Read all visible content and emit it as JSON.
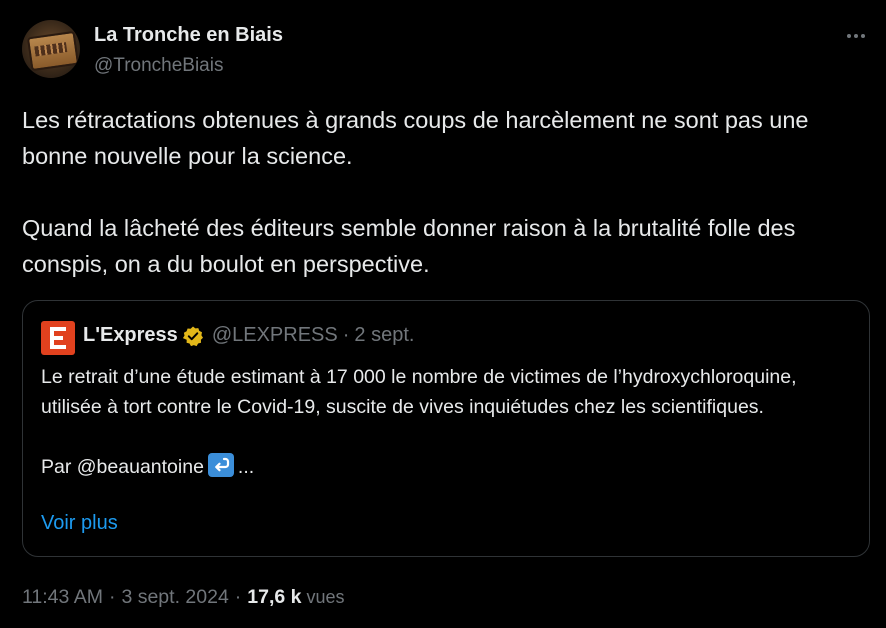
{
  "author": {
    "display_name": "La Tronche en Biais",
    "handle": "@TroncheBiais"
  },
  "tweet": {
    "paragraphs": [
      "Les rétractations obtenues à grands coups de harcèlement ne sont pas une bonne nouvelle pour la science.",
      "Quand la lâcheté des éditeurs semble donner raison à la brutalité folle des conspis, on a du boulot en perspective."
    ]
  },
  "quote": {
    "name": "L'Express",
    "handle": "@LEXPRESS",
    "separator": "·",
    "date": "2 sept.",
    "paragraphs": [
      "Le retrait d’une étude estimant à 17 000 le nombre de victimes de l’hydroxychloroquine, utilisée à tort contre le Covid-19, suscite de vives inquiétudes chez les scientifiques."
    ],
    "by_prefix": "Par ",
    "mention": "@beauantoine",
    "ellipsis": "...",
    "see_more": "Voir plus",
    "icons": {
      "verified": "verified-gold-badge-icon",
      "return": "return-arrow-emoji-icon"
    }
  },
  "meta": {
    "time": "11:43 AM",
    "separator": "·",
    "date": "3 sept. 2024",
    "views_count": "17,6 k",
    "views_label": "vues"
  },
  "colors": {
    "background": "#000000",
    "text_primary": "#e7e9ea",
    "text_secondary": "#71767b",
    "link": "#1d9bf0",
    "border": "#2f3336",
    "verified_gold": "#e2b719",
    "express_red": "#e1411e"
  }
}
